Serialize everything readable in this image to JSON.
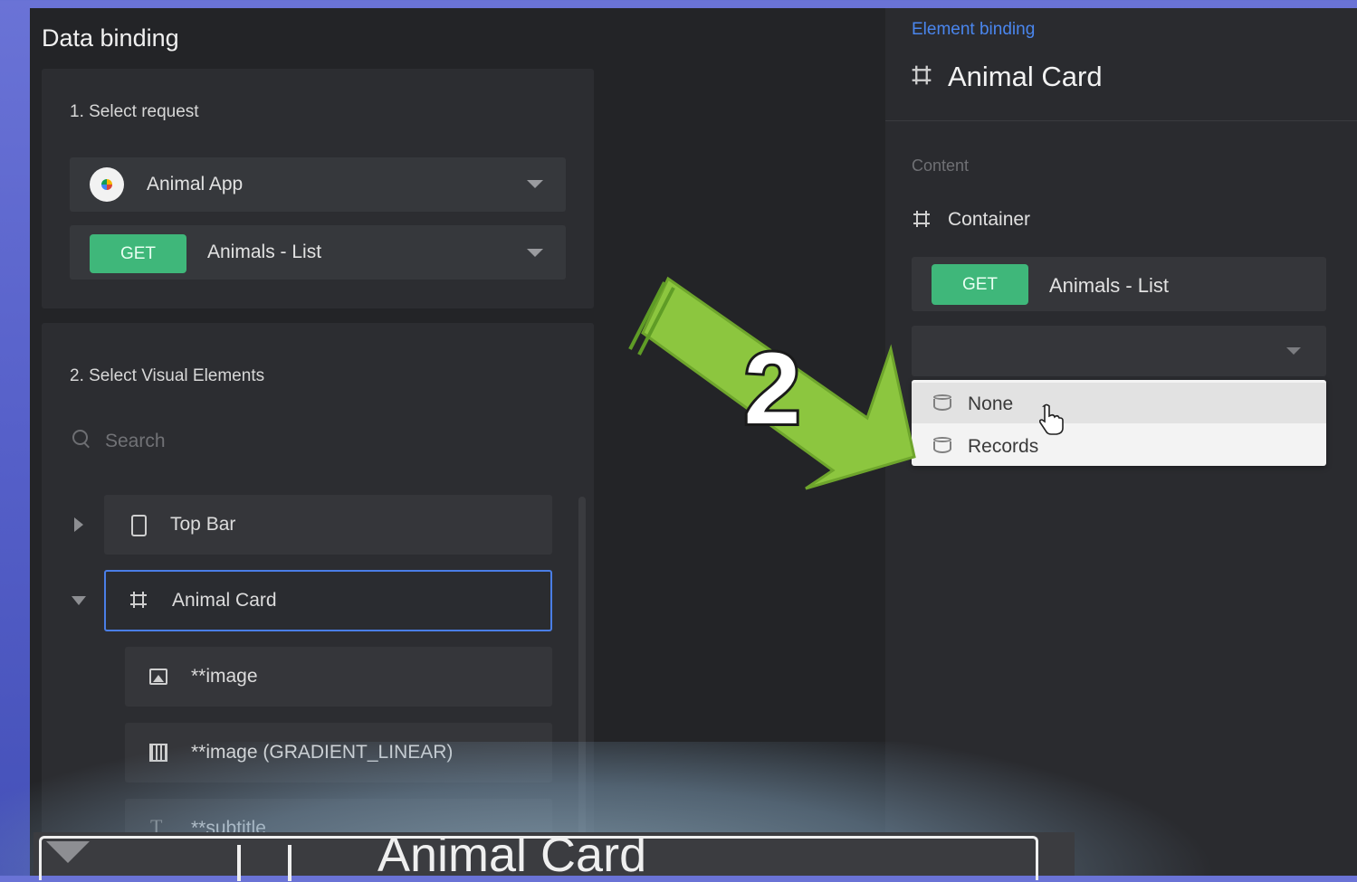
{
  "left_panel": {
    "title": "Data binding",
    "select_request": {
      "heading": "1. Select request",
      "app_name": "Animal App",
      "method": "GET",
      "request_name": "Animals - List"
    },
    "visual_elements": {
      "heading": "2. Select Visual Elements",
      "search_placeholder": "Search",
      "tree": [
        {
          "label": "Top Bar",
          "icon": "phone-icon",
          "expanded": false
        },
        {
          "label": "Animal Card",
          "icon": "frame-icon",
          "expanded": true,
          "selected": true
        },
        {
          "label": "**image",
          "icon": "image-icon"
        },
        {
          "label": "**image (GRADIENT_LINEAR)",
          "icon": "gradient-icon"
        },
        {
          "label": "**subtitle",
          "icon": "text-icon"
        }
      ]
    }
  },
  "right_panel": {
    "breadcrumb": "Element binding",
    "title": "Animal Card",
    "content_label": "Content",
    "container_label": "Container",
    "method": "GET",
    "request_name": "Animals - List",
    "dropdown_options": [
      "None",
      "Records"
    ],
    "hovered_option": "None"
  },
  "annotation": {
    "step_number": "2",
    "arrow_color": "#8cc63f"
  },
  "zoom_overlay": {
    "text": "Animal Card"
  },
  "colors": {
    "accent_green": "#3fb77a",
    "selection_blue": "#4a7ee6",
    "link_blue": "#4a86ee"
  }
}
